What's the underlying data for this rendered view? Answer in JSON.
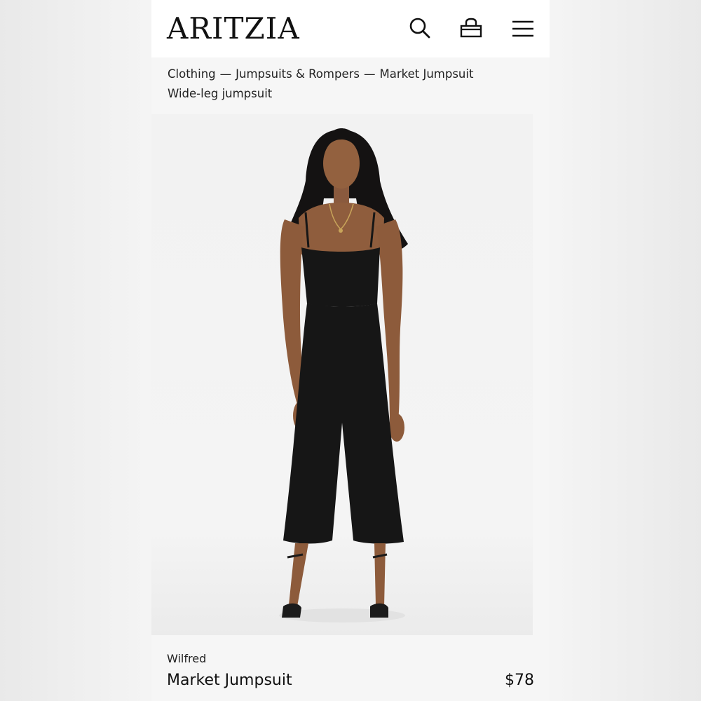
{
  "header": {
    "logo": "ARITZIA",
    "icons": [
      "search-icon",
      "shopping-bag-icon",
      "menu-icon"
    ]
  },
  "breadcrumb": {
    "items": [
      "Clothing",
      "Jumpsuits & Rompers",
      "Market Jumpsuit"
    ],
    "separator": "—",
    "subtitle": "Wide-leg jumpsuit"
  },
  "product": {
    "brand": "Wilfred",
    "name": "Market Jumpsuit",
    "price": "$78"
  },
  "colors": {
    "page_background": "#f4f4f4",
    "header_background": "#ffffff",
    "text": "#111111",
    "garment": "#161616"
  }
}
